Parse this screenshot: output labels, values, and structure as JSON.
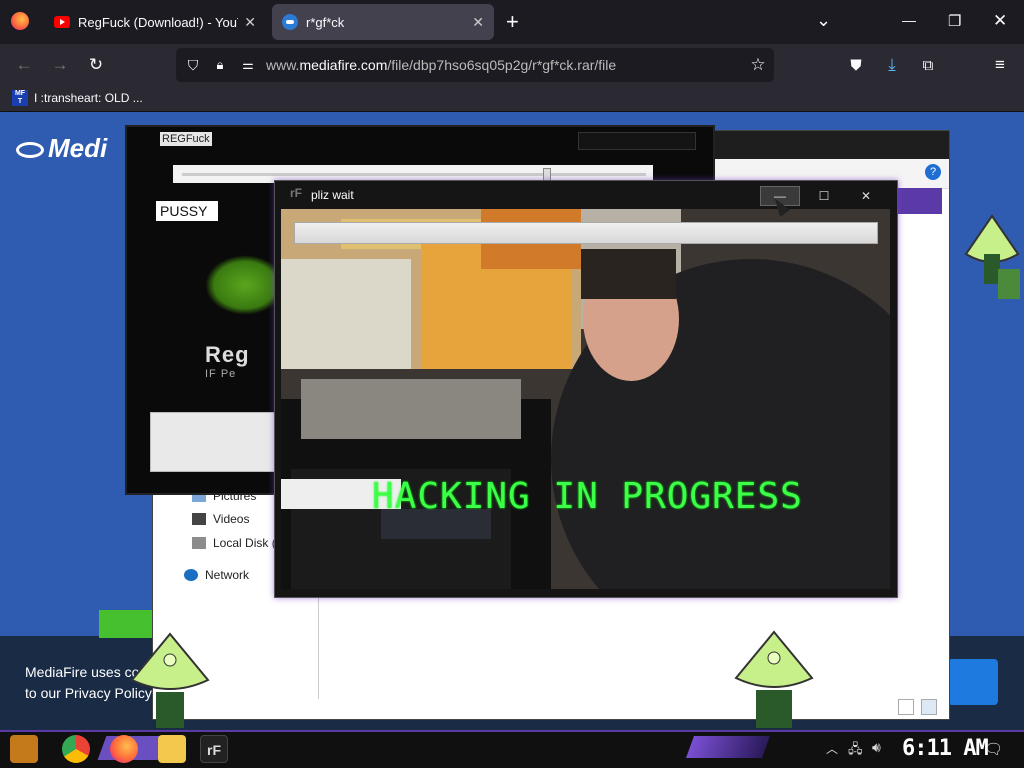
{
  "browser": {
    "tabs": [
      {
        "label": "RegFuck (Download!) - YouTube",
        "close": "✕"
      },
      {
        "label": "r*gf*ck",
        "close": "✕"
      }
    ],
    "new_tab": "+",
    "list_all_tabs": "⌄",
    "window_controls": {
      "minimize": "—",
      "restore": "❐",
      "close": "✕"
    },
    "url": {
      "prefix": "www.",
      "domain": "mediafire.com",
      "path": "/file/dbp7hso6sq05p2g/r*gf*ck.rar/file"
    },
    "bookmarks": [
      {
        "favicon_text": "MF T",
        "label": "I :transheart: OLD ..."
      }
    ]
  },
  "page": {
    "logo": "Medi",
    "privacy_line1": "MediaFire uses co",
    "privacy_line2": "to our Privacy Policy."
  },
  "explorer": {
    "items": [
      {
        "label": "Pictures"
      },
      {
        "label": "Videos"
      },
      {
        "label": "Local Disk ("
      },
      {
        "label": "Network"
      }
    ]
  },
  "regwindow": {
    "title": "REGFuck",
    "label": "PUSSY",
    "logo_text": "Reg",
    "logo_subtext": "IF Pe"
  },
  "waitwindow": {
    "title": "pliz wait",
    "icon": "rF",
    "min": "—",
    "max": "☐",
    "close": "✕",
    "overlay_text": "HACKING IN PROGRESS"
  },
  "taskbar": {
    "clock": "6:11 AM",
    "app_icon_label": "rF"
  },
  "colors": {
    "page_blue": "#2f5bb0",
    "hacking_green": "#3dff4a",
    "accent_purple": "#5b3aa8"
  }
}
